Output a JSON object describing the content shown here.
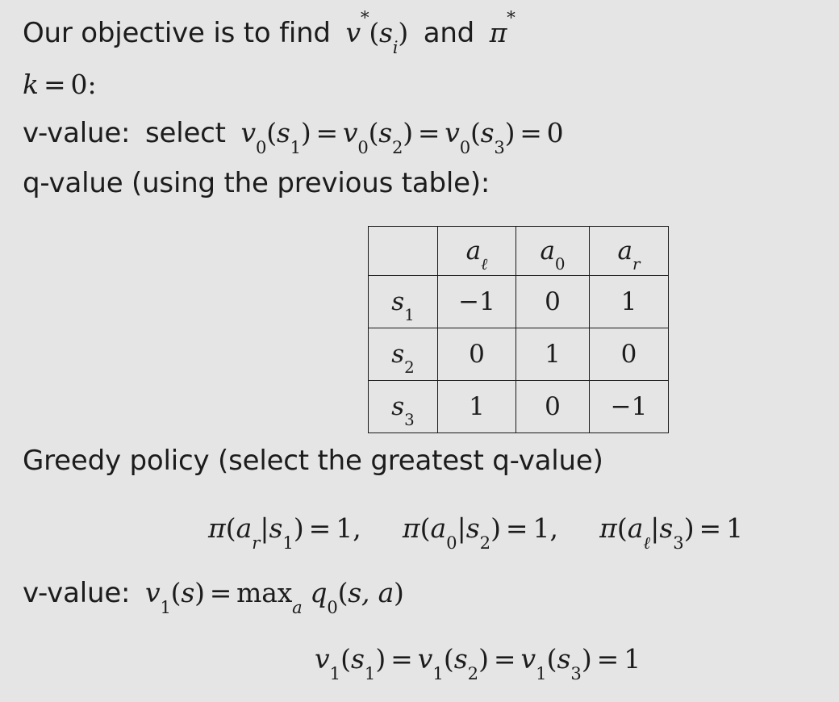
{
  "slide": {
    "background_color": "#e5e5e5",
    "text_color": "#1c1c1c",
    "accent_color": "#0a0ab8",
    "lines": {
      "objective": {
        "prefix": "Our objective is to find",
        "math_v": "v",
        "star": "*",
        "open": "(",
        "state": "s",
        "state_sub": "i",
        "close": ")",
        "conj": "and",
        "pi": "π",
        "pi_star": "*",
        "full_text": "Our objective is to find v*(s_i) and π*"
      },
      "iteration": {
        "k": "k",
        "equals": "=",
        "value": "0",
        "colon": ":",
        "full_text": "k = 0:"
      },
      "v_value_0": {
        "label": "v-value:",
        "verb": "select",
        "v": "v",
        "v_sub": "0",
        "s1": "s",
        "s1_sub": "1",
        "s2": "s",
        "s2_sub": "2",
        "s3": "s",
        "s3_sub": "3",
        "equals": "=",
        "result": "0",
        "full_text": "v-value: select v_0(s_1) = v_0(s_2) = v_0(s_3) = 0"
      },
      "q_value": {
        "full_text": "q-value (using the previous table):"
      },
      "greedy": {
        "full_text": "Greedy policy (select the greatest q-value)"
      },
      "policy": {
        "pi": "π",
        "items": [
          {
            "action": "a",
            "action_sub": "r",
            "state": "s",
            "state_sub": "1",
            "value": "1",
            "trailing": ","
          },
          {
            "action": "a",
            "action_sub": "0",
            "state": "s",
            "state_sub": "2",
            "value": "1",
            "trailing": ","
          },
          {
            "action": "a",
            "action_sub": "ℓ",
            "state": "s",
            "state_sub": "3",
            "value": "1",
            "trailing": ""
          }
        ],
        "bar": "|",
        "equals": "=",
        "full_text": "π(a_r|s_1) = 1,   π(a_0|s_2) = 1,   π(a_ℓ|s_3) = 1"
      },
      "v_value_1": {
        "label": "v-value:",
        "v": "v",
        "v_sub": "1",
        "arg": "s",
        "equals": "=",
        "max": "max",
        "max_sub": "a",
        "q": "q",
        "q_sub": "0",
        "q_args": "s, a",
        "full_text": "v-value: v_1(s) = max_a q_0(s, a)"
      },
      "v_final": {
        "v": "v",
        "v_sub": "1",
        "s1": "s",
        "s1_sub": "1",
        "s2": "s",
        "s2_sub": "2",
        "s3": "s",
        "s3_sub": "3",
        "equals": "=",
        "result": "1",
        "full_text": "v_1(s_1) = v_1(s_2) = v_1(s_3) = 1"
      }
    }
  },
  "q_table": {
    "corner_label": "",
    "column_headers": [
      {
        "symbol": "a",
        "sub": "ℓ",
        "text": "a_ℓ"
      },
      {
        "symbol": "a",
        "sub": "0",
        "text": "a_0"
      },
      {
        "symbol": "a",
        "sub": "r",
        "text": "a_r"
      }
    ],
    "rows": [
      {
        "header": {
          "symbol": "s",
          "sub": "1",
          "text": "s_1"
        },
        "values": [
          "−1",
          "0",
          "1"
        ]
      },
      {
        "header": {
          "symbol": "s",
          "sub": "2",
          "text": "s_2"
        },
        "values": [
          "0",
          "1",
          "0"
        ]
      },
      {
        "header": {
          "symbol": "s",
          "sub": "3",
          "text": "s_3"
        },
        "values": [
          "1",
          "0",
          "−1"
        ]
      }
    ]
  }
}
